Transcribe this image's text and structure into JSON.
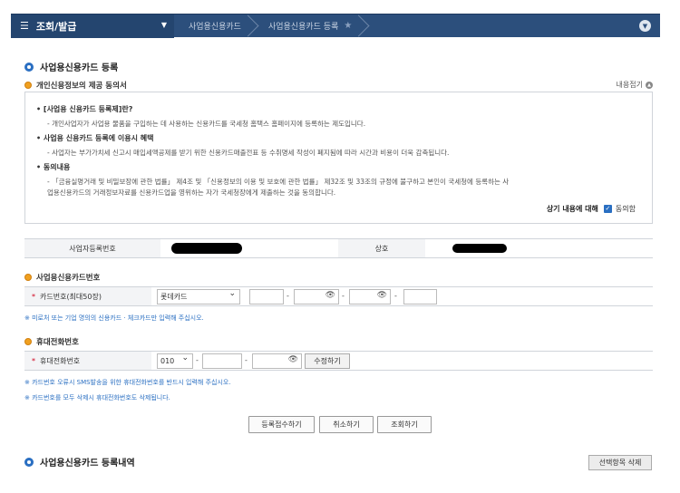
{
  "nav": {
    "menu_label": "조회/발급",
    "crumbs": [
      "사업용신용카드",
      "사업용신용카드 등록"
    ]
  },
  "page": {
    "title": "사업용신용카드 등록",
    "consent_title": "개인신용정보의 제공 동의서",
    "fold_label": "내용접기"
  },
  "agreement": {
    "q1": "[사업용 신용카드 등록제]란?",
    "a1": "- 개인사업자가 사업용 물품을 구입하는 데 사용하는 신용카드를 국세청 홈택스 홈페이지에 등록하는 제도입니다.",
    "q2": "사업용 신용카드 등록에 이용시 혜택",
    "a2": "- 사업자는 부가가치세 신고시 매입세액공제를 받기 위한 신용카드매출전표 등 수취명세 작성이 폐지됨에 따라 시간과 비용이 더욱 감축됩니다.",
    "q3": "동의내용",
    "a3_1": "- 「금융실명거래 및 비밀보장에 관한 법률」 제4조 및 「신용정보의 이용 및 보호에 관한 법률」 제32조 및 33조의 규정에 불구하고 본인이 국세청에 등록하는 사",
    "a3_2": "업용신용카드의 거래정보자료를 신용카드업을 영위하는 자가 국세청장에게 제출하는 것을 동의합니다.",
    "consent_label": "상기 내용에 대해",
    "consent_check": "동의함"
  },
  "business": {
    "reg_no_label": "사업자등록번호",
    "name_label": "상호"
  },
  "card": {
    "section": "사업용신용카드번호",
    "label": "카드번호(최대50장)",
    "company": "롯데카드",
    "note": "※ 미로처 또는 기업 명의의 신용카드 · 체크카드만 입력해 주십시오."
  },
  "phone": {
    "section": "휴대전화번호",
    "label": "휴대전화번호",
    "prefix": "010",
    "edit_button": "수정하기",
    "note1": "※ 카드번호 오류시 SMS발송을 위한 휴대전화번호를 반드시 입력해 주십시오.",
    "note2": "※ 카드번호를 모두 삭제시 휴대전화번호도 삭제됩니다."
  },
  "actions": {
    "submit": "등록접수하기",
    "cancel": "취소하기",
    "lookup": "조회하기"
  },
  "history": {
    "title": "사업용신용카드 등록내역",
    "delete_selected": "선택항목 삭제"
  },
  "colors": {
    "nav_bg": "#2c4f7c",
    "accent": "#2a6fc2",
    "required": "#d0021b"
  }
}
